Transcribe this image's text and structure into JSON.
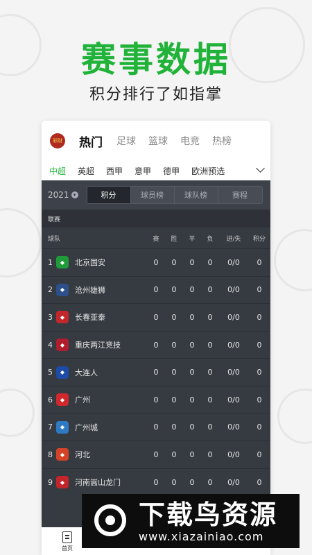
{
  "hero": {
    "title": "赛事数据",
    "subtitle": "积分排行了如指掌"
  },
  "app": {
    "logo_text": "彩财",
    "categories": [
      "热门",
      "足球",
      "篮球",
      "电竞",
      "热榜"
    ],
    "active_category": "热门",
    "leagues": [
      "中超",
      "英超",
      "西甲",
      "意甲",
      "德甲",
      "欧洲预选"
    ],
    "active_league": "中超",
    "season": "2021",
    "segments": [
      "积分",
      "球员榜",
      "球队榜",
      "赛程"
    ],
    "active_segment": "积分",
    "section_label": "联赛",
    "columns": {
      "team": "球队",
      "played": "赛",
      "won": "胜",
      "draw": "平",
      "lost": "负",
      "goals": "进/失",
      "points": "积分"
    },
    "rows": [
      {
        "rank": "1",
        "team": "北京国安",
        "played": "0",
        "won": "0",
        "draw": "0",
        "lost": "0",
        "goals": "0/0",
        "points": "0",
        "color": "#1f9b3a"
      },
      {
        "rank": "2",
        "team": "沧州雄狮",
        "played": "0",
        "won": "0",
        "draw": "0",
        "lost": "0",
        "goals": "0/0",
        "points": "0",
        "color": "#2d4f8a"
      },
      {
        "rank": "3",
        "team": "长春亚泰",
        "played": "0",
        "won": "0",
        "draw": "0",
        "lost": "0",
        "goals": "0/0",
        "points": "0",
        "color": "#c3272b"
      },
      {
        "rank": "4",
        "team": "重庆两江竞技",
        "played": "0",
        "won": "0",
        "draw": "0",
        "lost": "0",
        "goals": "0/0",
        "points": "0",
        "color": "#b01e2e"
      },
      {
        "rank": "5",
        "team": "大连人",
        "played": "0",
        "won": "0",
        "draw": "0",
        "lost": "0",
        "goals": "0/0",
        "points": "0",
        "color": "#1e4aa8"
      },
      {
        "rank": "6",
        "team": "广州",
        "played": "0",
        "won": "0",
        "draw": "0",
        "lost": "0",
        "goals": "0/0",
        "points": "0",
        "color": "#d0282d"
      },
      {
        "rank": "7",
        "team": "广州城",
        "played": "0",
        "won": "0",
        "draw": "0",
        "lost": "0",
        "goals": "0/0",
        "points": "0",
        "color": "#2e7ac3"
      },
      {
        "rank": "8",
        "team": "河北",
        "played": "0",
        "won": "0",
        "draw": "0",
        "lost": "0",
        "goals": "0/0",
        "points": "0",
        "color": "#d44327"
      },
      {
        "rank": "9",
        "team": "河南嵩山龙门",
        "played": "0",
        "won": "0",
        "draw": "0",
        "lost": "0",
        "goals": "0/0",
        "points": "0",
        "color": "#c2262b"
      }
    ],
    "tabbar": {
      "home_label": "首页"
    }
  },
  "watermark": {
    "title": "下载鸟资源",
    "url": "www.xiazainiao.com"
  },
  "colors": {
    "accent_green": "#21b339",
    "table_bg": "#363b42"
  }
}
